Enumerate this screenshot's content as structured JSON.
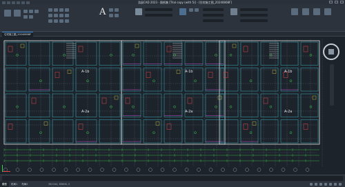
{
  "titlebar": {
    "title": "浩辰CAD 2023 - 图纸集 [Trial copy (with 5)] - [住宅施工图_20240808F]"
  },
  "doc_tabs": [
    {
      "label": "住宅施工图_20240808F"
    }
  ],
  "layout_tabs": [
    "模型",
    "布局1",
    "布局2"
  ],
  "status": {
    "coords": "381344, 85608, 0"
  },
  "units": [
    "A-1b",
    "A-1b",
    "A-1b",
    "A-2a",
    "A-2a",
    "A-2a"
  ],
  "colors": {
    "background": "#1d232b",
    "wall_white": "#e6e6e6",
    "cyan": "#3fd3e0",
    "green": "#37d64a",
    "red": "#e04646",
    "magenta": "#c853d6",
    "yellow": "#d9d64a"
  }
}
